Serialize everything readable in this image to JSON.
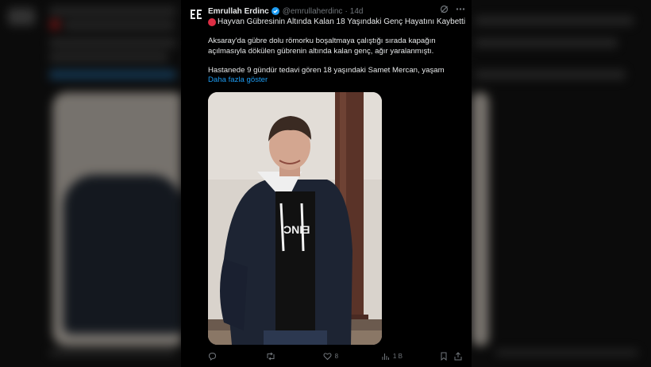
{
  "tweet": {
    "author_name": "Emrullah Erdinc",
    "handle": "@emrullaherdinc",
    "separator": "·",
    "time": "14d",
    "title": "Hayvan Gübresinin Altında Kalan 18 Yaşındaki Genç Hayatını Kaybetti",
    "paragraph1": "Aksaray'da gübre dolu römorku boşaltmaya çalıştığı sırada kapağın açılmasıyla dökülen gübrenin altında kalan genç, ağır yaralanmıştı.",
    "paragraph2": "Hastanede 9 gündür tedavi gören 18 yaşındaki Samet Mercan, yaşam",
    "show_more": "Daha fazla göster",
    "likes": "8",
    "views": "1 B"
  },
  "icons": {
    "avatar": "ee-logo-icon",
    "verified": "verified-badge-icon",
    "grok": "grok-icon",
    "more": "more-icon",
    "reply": "reply-icon",
    "retweet": "retweet-icon",
    "like": "heart-icon",
    "views": "views-icon",
    "bookmark": "bookmark-icon",
    "share": "share-icon"
  },
  "colors": {
    "background": "#000000",
    "text": "#e7e9ea",
    "muted": "#71767b",
    "link": "#1d9bf0",
    "red_dot": "#dd2e44"
  }
}
